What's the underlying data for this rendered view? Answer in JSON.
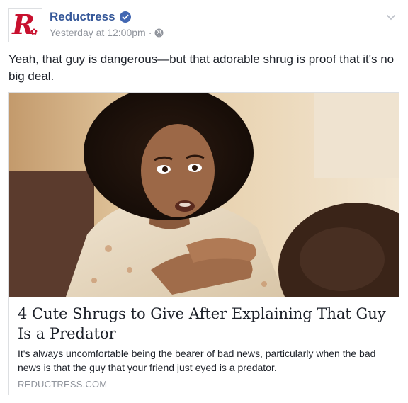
{
  "post": {
    "page_name": "Reductress",
    "timestamp": "Yesterday at 12:00pm",
    "separator": "·",
    "audience_icon": "globe-icon",
    "verified_icon": "verified-badge-icon",
    "menu_icon": "chevron-down-icon",
    "message": "Yeah, that guy is dangerous—but that adorable shrug is proof that it's no big deal."
  },
  "link_card": {
    "title": "4 Cute Shrugs to Give After Explaining That Guy Is a Predator",
    "description": "It's always uncomfortable being the bearer of bad news, particularly when the bad news is that the guy that your friend just eyed is a predator.",
    "domain": "REDUCTRESS.COM"
  },
  "colors": {
    "link_blue": "#365899",
    "verified_blue": "#4267b2",
    "brand_red": "#c8102e",
    "meta_gray": "#90949c"
  }
}
